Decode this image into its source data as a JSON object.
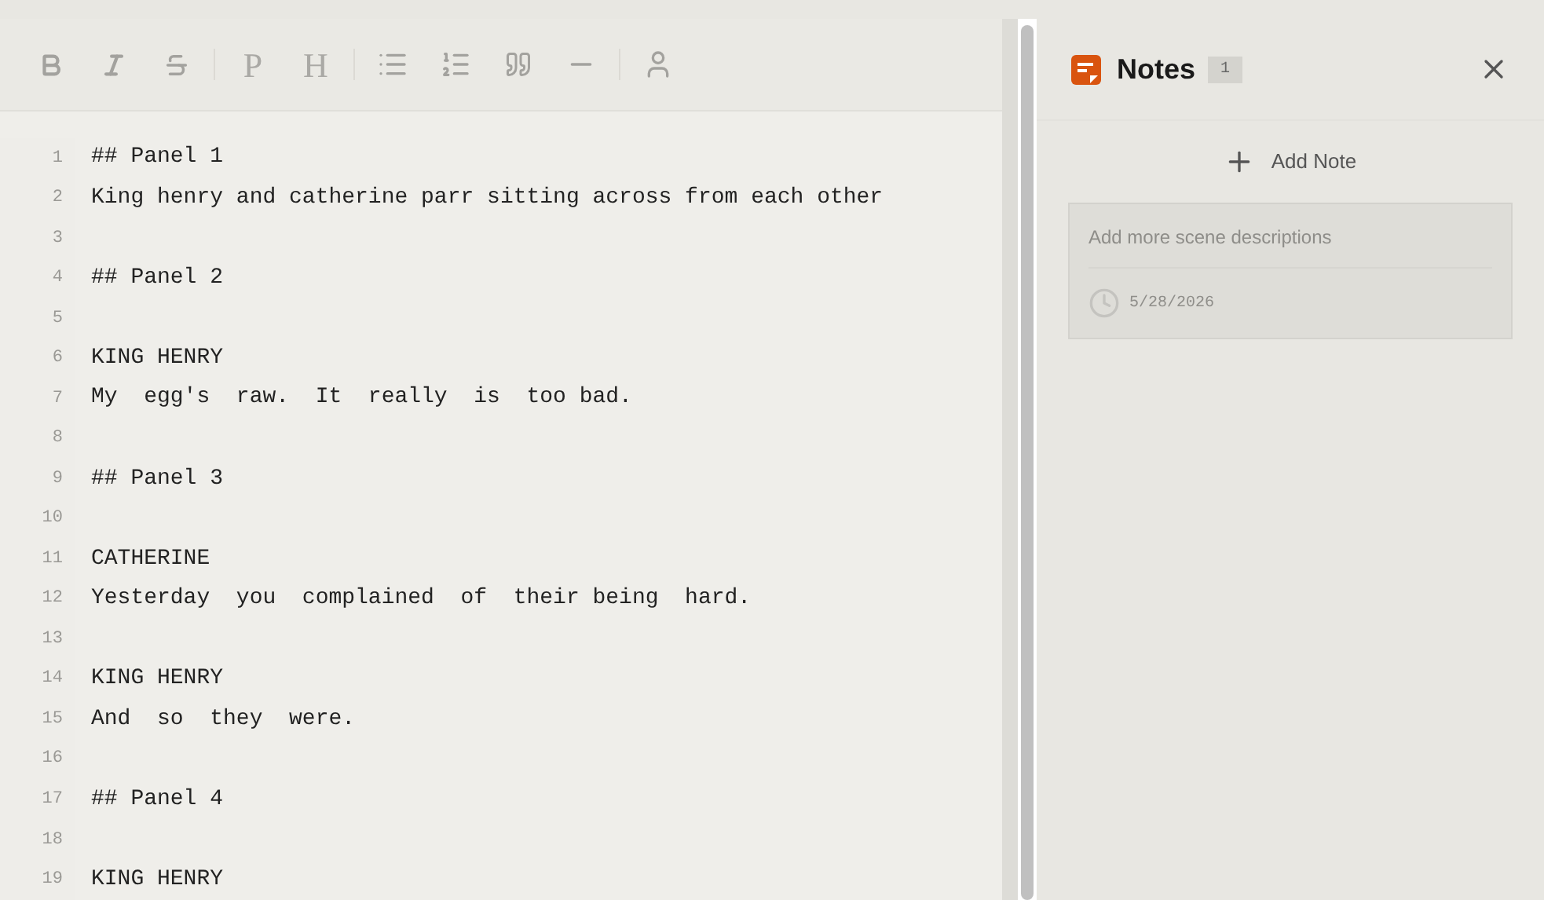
{
  "toolbar": {
    "letter_buttons": [
      "P",
      "H"
    ]
  },
  "editor": {
    "lines": [
      {
        "number": "1",
        "text": "## Panel 1"
      },
      {
        "number": "2",
        "text": "King henry and catherine parr sitting across from each other"
      },
      {
        "number": "3"
      },
      {
        "number": "4",
        "text": "## Panel 2"
      },
      {
        "number": "5"
      },
      {
        "number": "6",
        "text": "KING HENRY"
      },
      {
        "number": "7",
        "text": "My  egg's  raw.  It  really  is  too bad."
      },
      {
        "number": "8"
      },
      {
        "number": "9",
        "text": "## Panel 3"
      },
      {
        "number": "10"
      },
      {
        "number": "11",
        "text": "CATHERINE"
      },
      {
        "number": "12",
        "text": "Yesterday  you  complained  of  their being  hard."
      },
      {
        "number": "13"
      },
      {
        "number": "14",
        "text": "KING HENRY"
      },
      {
        "number": "15",
        "text": "And  so  they  were."
      },
      {
        "number": "16"
      },
      {
        "number": "17",
        "text": "## Panel 4"
      },
      {
        "number": "18"
      },
      {
        "number": "19",
        "text": "KING HENRY"
      }
    ]
  },
  "notes_panel": {
    "title": "Notes",
    "count": "1",
    "add_label": "Add Note",
    "notes": [
      {
        "text": "Add more scene descriptions",
        "date": "5/28/2026"
      }
    ]
  }
}
